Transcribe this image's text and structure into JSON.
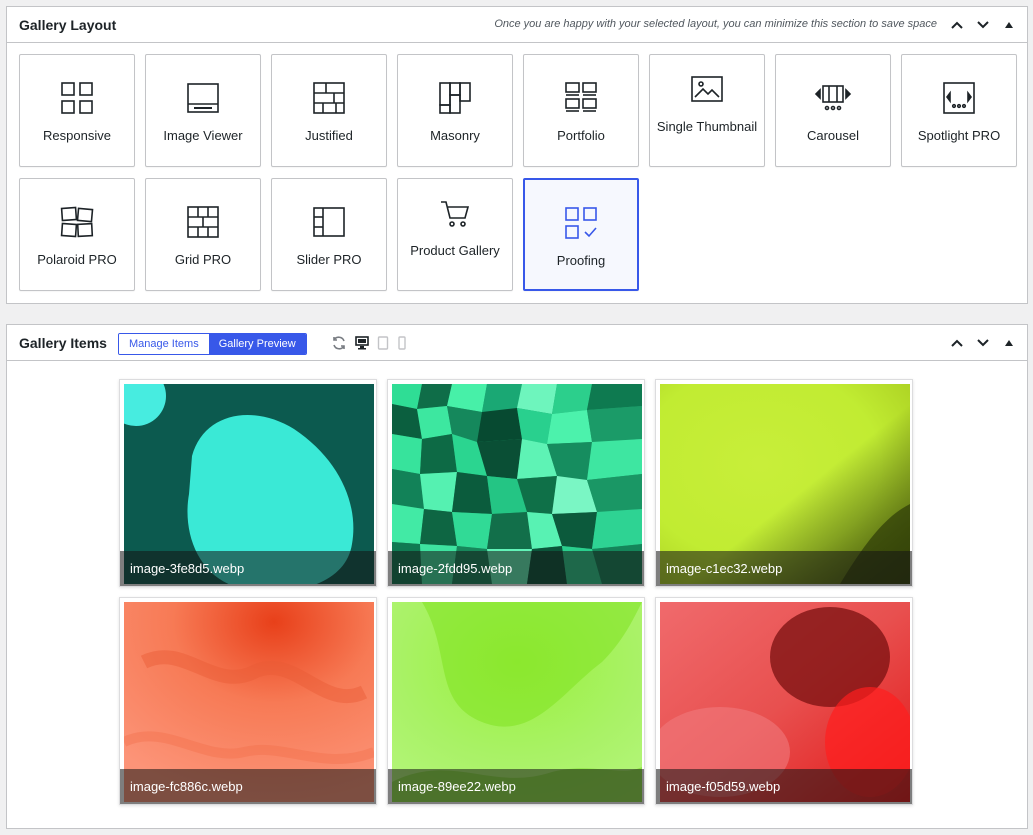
{
  "layout_panel": {
    "title": "Gallery Layout",
    "note": "Once you are happy with your selected layout, you can minimize this section to save space",
    "tiles": [
      {
        "label": "Responsive"
      },
      {
        "label": "Image Viewer"
      },
      {
        "label": "Justified"
      },
      {
        "label": "Masonry"
      },
      {
        "label": "Portfolio"
      },
      {
        "label": "Single Thumbnail"
      },
      {
        "label": "Carousel"
      },
      {
        "label": "Spotlight PRO"
      },
      {
        "label": "Polaroid PRO"
      },
      {
        "label": "Grid PRO"
      },
      {
        "label": "Slider PRO"
      },
      {
        "label": "Product Gallery"
      },
      {
        "label": "Proofing"
      }
    ],
    "selected": "Proofing",
    "accent_color": "#3858e9"
  },
  "items_panel": {
    "title": "Gallery Items",
    "manage_label": "Manage Items",
    "preview_label": "Gallery Preview",
    "images": [
      {
        "name": "image-3fe8d5.webp",
        "color": "#3fe8d5"
      },
      {
        "name": "image-2fdd95.webp",
        "color": "#2fdd95"
      },
      {
        "name": "image-c1ec32.webp",
        "color": "#c1ec32"
      },
      {
        "name": "image-fc886c.webp",
        "color": "#fc886c"
      },
      {
        "name": "image-89ee22.webp",
        "color": "#89ee22"
      },
      {
        "name": "image-f05d59.webp",
        "color": "#f05d59"
      }
    ]
  },
  "icons": [
    "chevron-up-icon",
    "chevron-down-icon",
    "collapse-triangle-icon",
    "refresh-icon",
    "desktop-icon",
    "tablet-icon",
    "mobile-icon"
  ]
}
